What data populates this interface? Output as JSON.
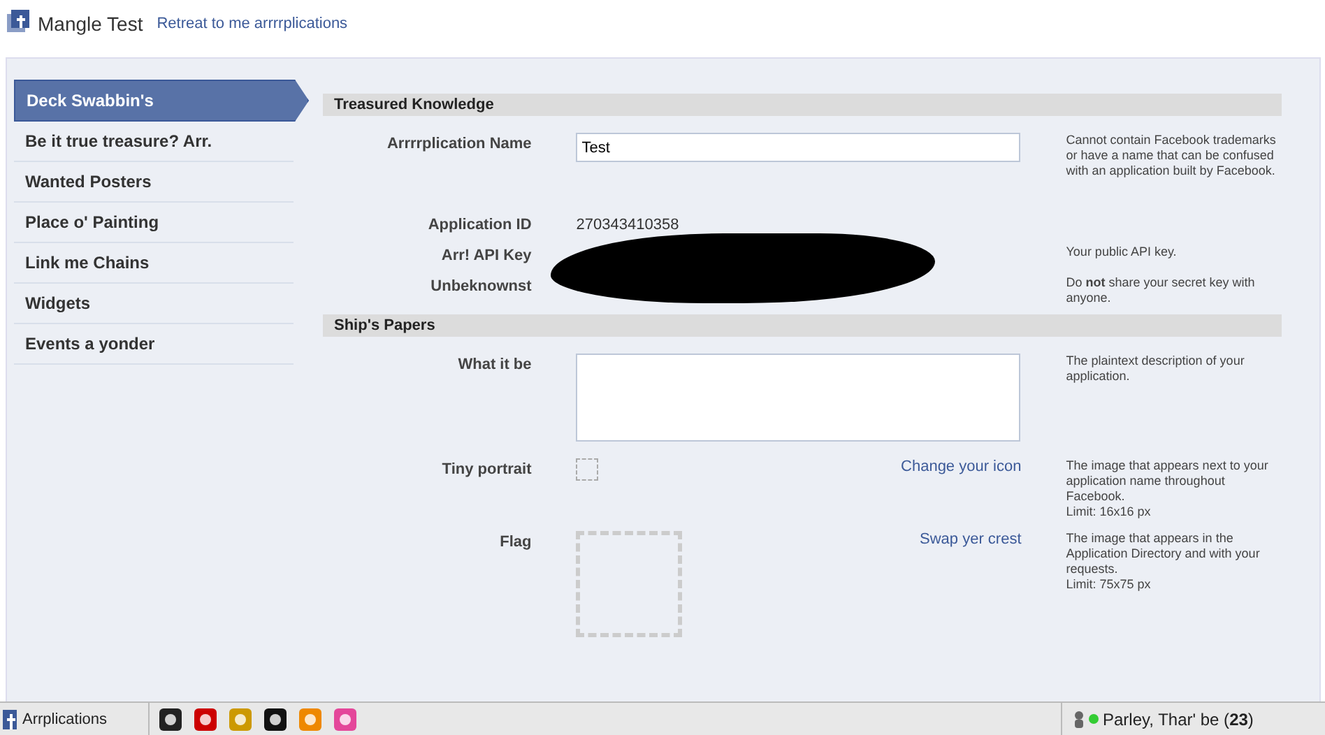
{
  "header": {
    "title": "Mangle Test",
    "back_link": "Retreat to me arrrrplications"
  },
  "sidebar": {
    "items": [
      {
        "label": "Deck Swabbin's",
        "selected": true
      },
      {
        "label": "Be it true treasure? Arr.",
        "selected": false
      },
      {
        "label": "Wanted Posters",
        "selected": false
      },
      {
        "label": "Place o' Painting",
        "selected": false
      },
      {
        "label": "Link me Chains",
        "selected": false
      },
      {
        "label": "Widgets",
        "selected": false
      },
      {
        "label": "Events a yonder",
        "selected": false
      }
    ]
  },
  "sections": [
    {
      "title": "Treasured Knowledge",
      "rows": [
        {
          "kind": "input",
          "label": "Arrrrplication Name",
          "value": "Test",
          "help": "Cannot contain Facebook trademarks or have a name that can be confused with an application built by Facebook."
        },
        {
          "kind": "text",
          "label": "Application ID",
          "value": "270343410358"
        },
        {
          "kind": "redacted",
          "label": "Arr! API Key",
          "help": "Your public API key."
        },
        {
          "kind": "redacted",
          "label": "Unbeknownst",
          "help": "Do **not** share your secret key with anyone."
        }
      ]
    },
    {
      "title": "Ship's Papers",
      "rows": [
        {
          "kind": "textarea",
          "label": "What it be",
          "help": "The plaintext description of your application."
        },
        {
          "kind": "image_small",
          "label": "Tiny portrait",
          "link": "Change your icon",
          "help": "The image that appears next to your application name throughout Facebook.",
          "limit": "Limit: 16x16 px"
        },
        {
          "kind": "image_large",
          "label": "Flag",
          "link": "Swap yer crest",
          "help": "The image that appears in the Application Directory and with your requests.",
          "limit": "Limit: 75x75 px"
        }
      ]
    }
  ],
  "taskbar": {
    "apps_label": "Arrplications",
    "chat": "Parley, Thar' be (**23**)"
  }
}
